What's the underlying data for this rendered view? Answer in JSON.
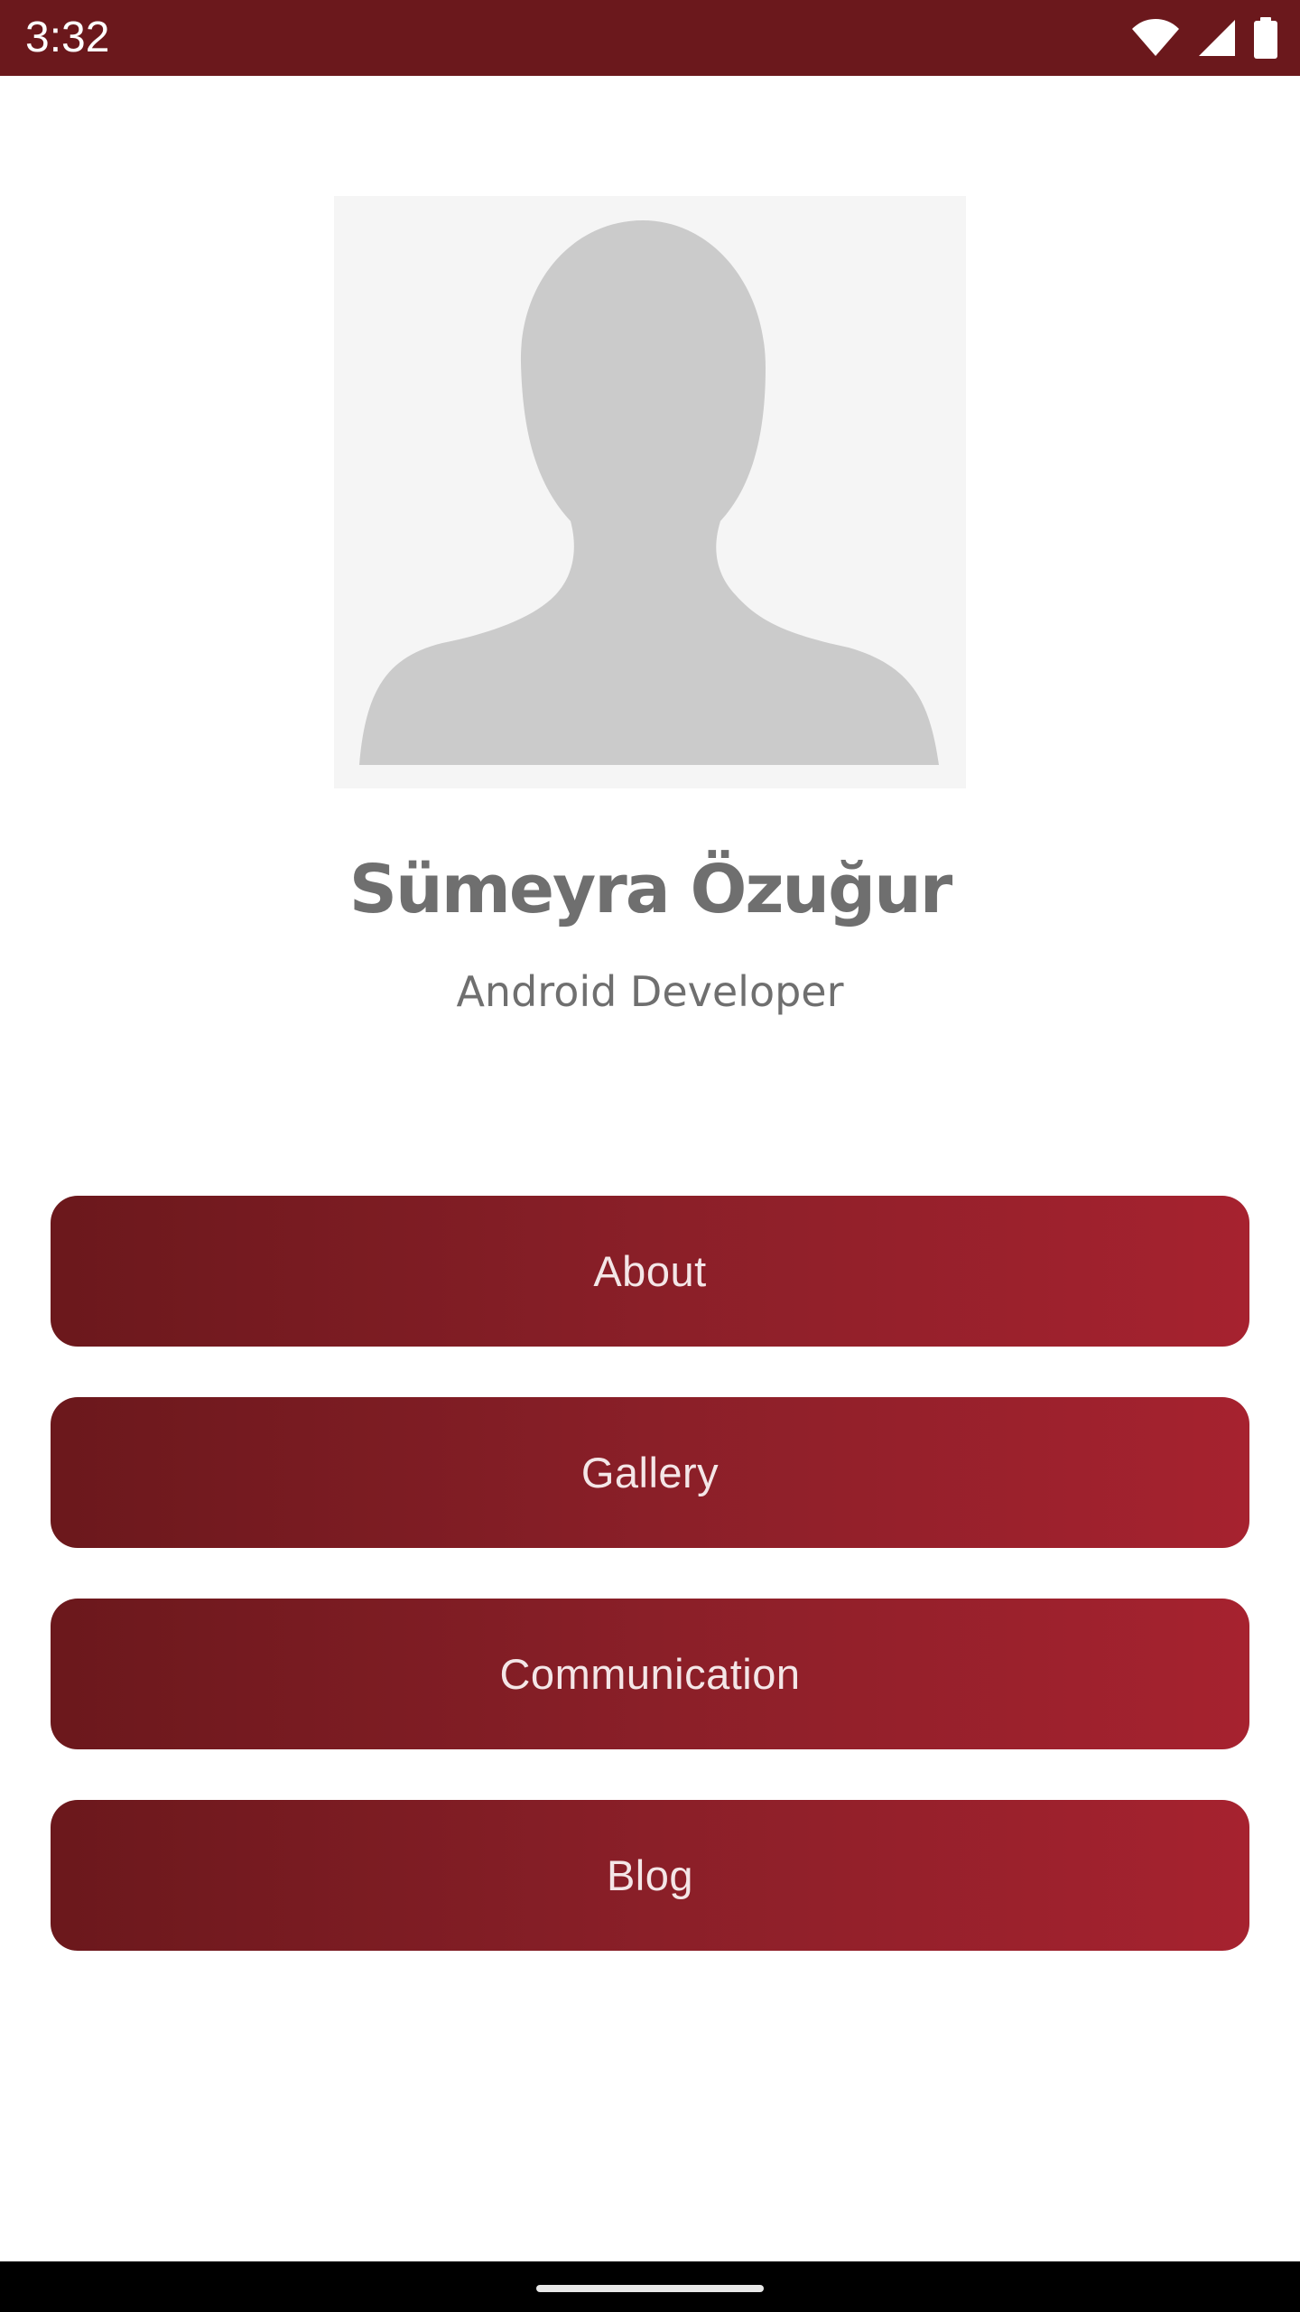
{
  "status_bar": {
    "time": "3:32",
    "icons": [
      "wifi-icon",
      "cellular-signal-icon",
      "battery-icon"
    ]
  },
  "profile": {
    "avatar": "default-person-placeholder",
    "name": "Sümeyra Özuğur",
    "role": "Android Developer"
  },
  "menu": {
    "about_label": "About",
    "gallery_label": "Gallery",
    "communication_label": "Communication",
    "blog_label": "Blog"
  },
  "colors": {
    "status_bar": "#6b181c",
    "button_gradient_start": "#6b181c",
    "button_gradient_end": "#a6222f",
    "text_gray": "#6f6f6f",
    "avatar_background": "#f5f5f5",
    "avatar_silhouette": "#cbcbcb"
  }
}
